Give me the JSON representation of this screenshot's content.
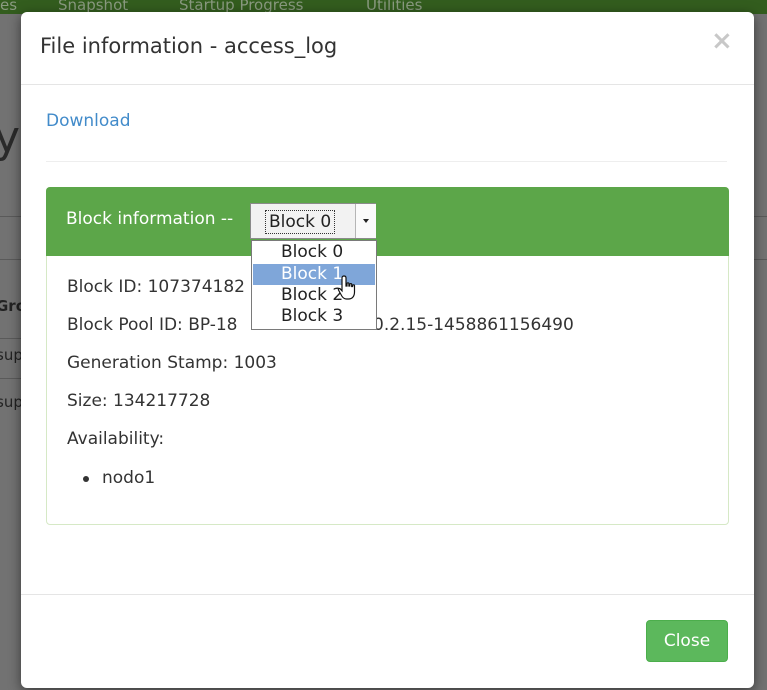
{
  "background": {
    "nav_items": [
      "es",
      "Snapshot",
      "Startup Progress",
      "Utilities"
    ],
    "heading_fragment": "y",
    "table_header_fragment": "Gro",
    "row_fragments": [
      "sup",
      "sup"
    ]
  },
  "modal": {
    "title": "File information - access_log",
    "close_glyph": "×",
    "download_label": "Download",
    "panel": {
      "heading_label": "Block information --",
      "select": {
        "value": "Block 0",
        "options": [
          "Block 0",
          "Block 1",
          "Block 2",
          "Block 3"
        ],
        "highlighted": "Block 1"
      },
      "block_id_visible": "Block ID: 107374182",
      "block_pool_id_left": "Block Pool ID: BP-18",
      "block_pool_id_right": "0.2.15-1458861156490",
      "generation_stamp": "Generation Stamp: 1003",
      "size": "Size: 134217728",
      "availability_label": "Availability:",
      "availability_nodes": [
        "nodo1"
      ]
    },
    "close_button_label": "Close"
  },
  "colors": {
    "panel_heading": "#5ca649",
    "close_button": "#5cb85c",
    "link": "#428bca",
    "selected_option": "#7fa6d9",
    "navbar": "#335d1e"
  },
  "icons": {
    "cursor": "hand-pointer-icon",
    "select_arrow": "caret-down-icon",
    "close": "close-icon"
  }
}
